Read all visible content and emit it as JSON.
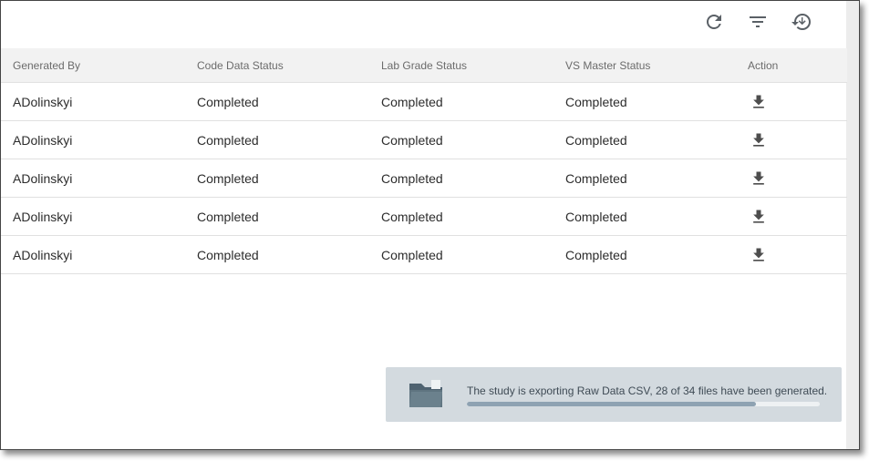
{
  "toolbar": {
    "icons": [
      "refresh-icon",
      "filter-icon",
      "export-history-icon"
    ]
  },
  "table": {
    "headers": [
      "Generated By",
      "Code Data Status",
      "Lab Grade Status",
      "VS Master Status",
      "Action"
    ],
    "rows": [
      [
        "ADolinskyi",
        "Completed",
        "Completed",
        "Completed",
        "download-icon"
      ],
      [
        "ADolinskyi",
        "Completed",
        "Completed",
        "Completed",
        "download-icon"
      ],
      [
        "ADolinskyi",
        "Completed",
        "Completed",
        "Completed",
        "download-icon"
      ],
      [
        "ADolinskyi",
        "Completed",
        "Completed",
        "Completed",
        "download-icon"
      ],
      [
        "ADolinskyi",
        "Completed",
        "Completed",
        "Completed",
        "download-icon"
      ]
    ]
  },
  "toast": {
    "icon": "folder-icon",
    "message": "The study is exporting Raw Data CSV, 28 of 34 files have been generated.",
    "progress_fraction": 0.82
  },
  "colors": {
    "toast_bg": "#d3dadf",
    "progress_fill": "#8ea2b2",
    "folder": "#5f7480"
  }
}
